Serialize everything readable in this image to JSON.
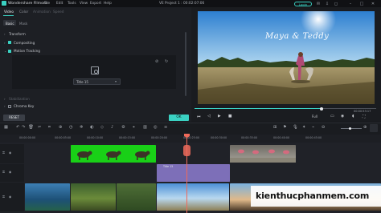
{
  "titlebar": {
    "app_name": "Wondershare Filmora",
    "menus": [
      "File",
      "Edit",
      "Tools",
      "View",
      "Export",
      "Help"
    ],
    "project_title": "VE Project 1 : 00:02:07:06",
    "login_label": "Login"
  },
  "left_panel": {
    "tabs": [
      "Video",
      "Color",
      "Animation",
      "Speed"
    ],
    "subtabs": [
      "Basic",
      "Mask"
    ],
    "sections": {
      "transform": "Transform",
      "compositing": "Compositing",
      "motion_tracking": "Motion Tracking",
      "stabilization": "Stabilization",
      "chroma_key": "Chroma Key"
    },
    "tracking_select_value": "Title 15",
    "reset_label": "RESET",
    "ok_label": "OK"
  },
  "preview": {
    "overlay_text": "Maya & Teddy",
    "progress": 0.7,
    "timecode": "00:00:53:17",
    "quality": "Full"
  },
  "timeline": {
    "ruler_ticks": [
      "00:00:00:00",
      "00:00:05:00",
      "00:00:10:00",
      "00:00:15:00",
      "00:00:20:00",
      "00:00:25:00",
      "00:00:30:00",
      "00:00:35:00",
      "00:00:40:00",
      "00:00:45:00"
    ],
    "title_clip": "Title 15",
    "zoom_level": 0.45
  },
  "watermark": "kienthucphanmem.com",
  "colors": {
    "accent": "#3ad1c2",
    "playhead": "#f06a5a",
    "title_clip": "#7d6fb8",
    "green_screen": "#19d017"
  }
}
